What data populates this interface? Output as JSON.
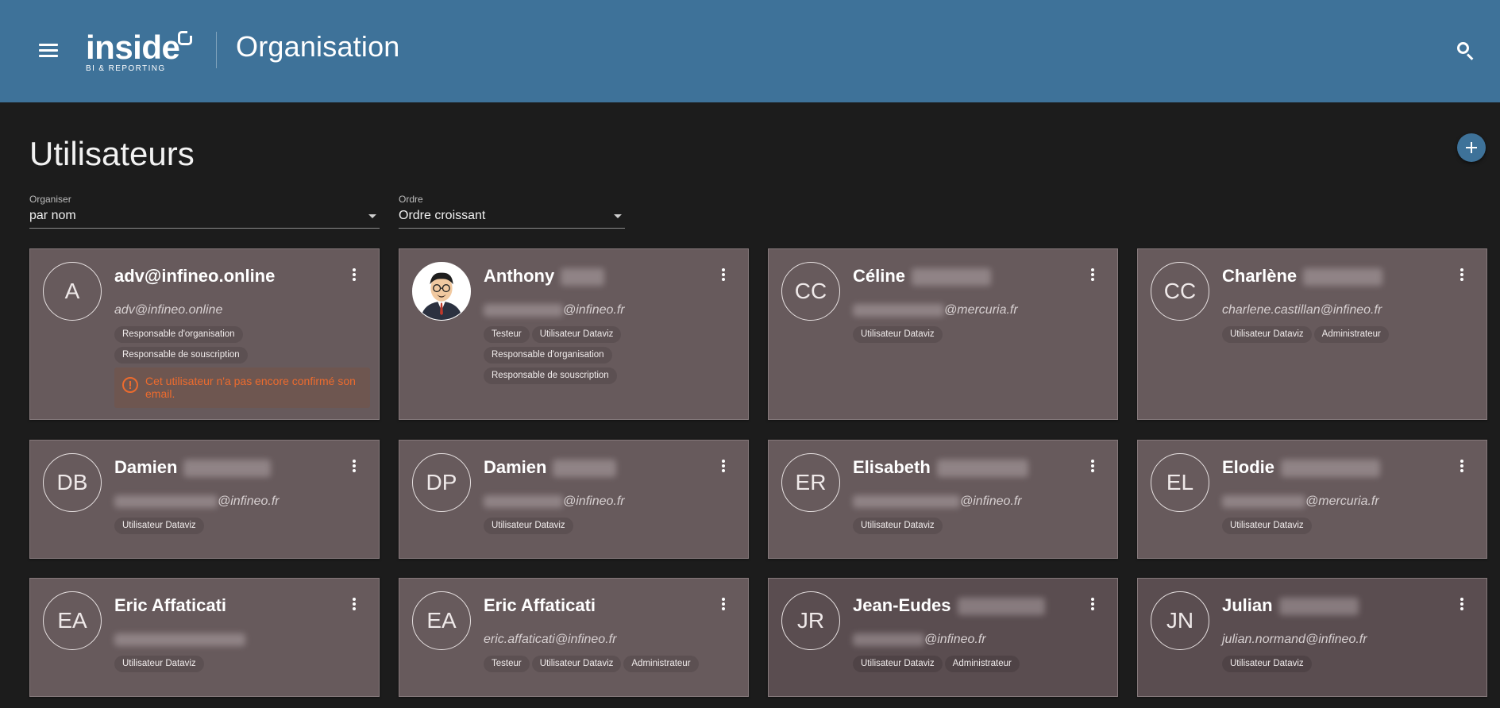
{
  "header": {
    "logo_word": "inside",
    "logo_sub": "BI & REPORTING",
    "title": "Organisation"
  },
  "page": {
    "title": "Utilisateurs"
  },
  "filters": {
    "organize": {
      "label": "Organiser",
      "value": "par nom"
    },
    "order": {
      "label": "Ordre",
      "value": "Ordre croissant"
    }
  },
  "colors": {
    "header": "#3e7299",
    "background": "#1c1c1c",
    "card": "#675a5c",
    "warning": "#ec6b2e"
  },
  "users": [
    {
      "initials": "A",
      "name": "adv@infineo.online",
      "email": "adv@infineo.online",
      "roles": [
        "Responsable d'organisation",
        "Responsable de souscription"
      ],
      "warning": "Cet utilisateur n'a pas encore confirmé son email."
    },
    {
      "initials": "",
      "name": "Anthony",
      "email": "@infineo.fr",
      "roles": [
        "Testeur",
        "Utilisateur Dataviz",
        "Responsable d'organisation",
        "Responsable de souscription"
      ],
      "photo": true
    },
    {
      "initials": "CC",
      "name": "Céline",
      "email": "@mercuria.fr",
      "roles": [
        "Utilisateur Dataviz"
      ]
    },
    {
      "initials": "CC",
      "name": "Charlène",
      "email": "charlene.castillan@infineo.fr",
      "roles": [
        "Utilisateur Dataviz",
        "Administrateur"
      ]
    },
    {
      "initials": "DB",
      "name": "Damien",
      "email": "@infineo.fr",
      "roles": [
        "Utilisateur Dataviz"
      ]
    },
    {
      "initials": "DP",
      "name": "Damien",
      "email": "@infineo.fr",
      "roles": [
        "Utilisateur Dataviz"
      ]
    },
    {
      "initials": "ER",
      "name": "Elisabeth",
      "email": "@infineo.fr",
      "roles": [
        "Utilisateur Dataviz"
      ]
    },
    {
      "initials": "EL",
      "name": "Elodie",
      "email": "@mercuria.fr",
      "roles": [
        "Utilisateur Dataviz"
      ]
    },
    {
      "initials": "EA",
      "name": "Eric Affaticati",
      "email": "",
      "roles": [
        "Utilisateur Dataviz"
      ]
    },
    {
      "initials": "EA",
      "name": "Eric Affaticati",
      "email": "eric.affaticati@infineo.fr",
      "roles": [
        "Testeur",
        "Utilisateur Dataviz",
        "Administrateur"
      ]
    },
    {
      "initials": "JR",
      "name": "Jean-Eudes",
      "email": "@infineo.fr",
      "roles": [
        "Utilisateur Dataviz",
        "Administrateur"
      ]
    },
    {
      "initials": "JN",
      "name": "Julian",
      "email": "julian.normand@infineo.fr",
      "roles": [
        "Utilisateur Dataviz"
      ]
    }
  ]
}
